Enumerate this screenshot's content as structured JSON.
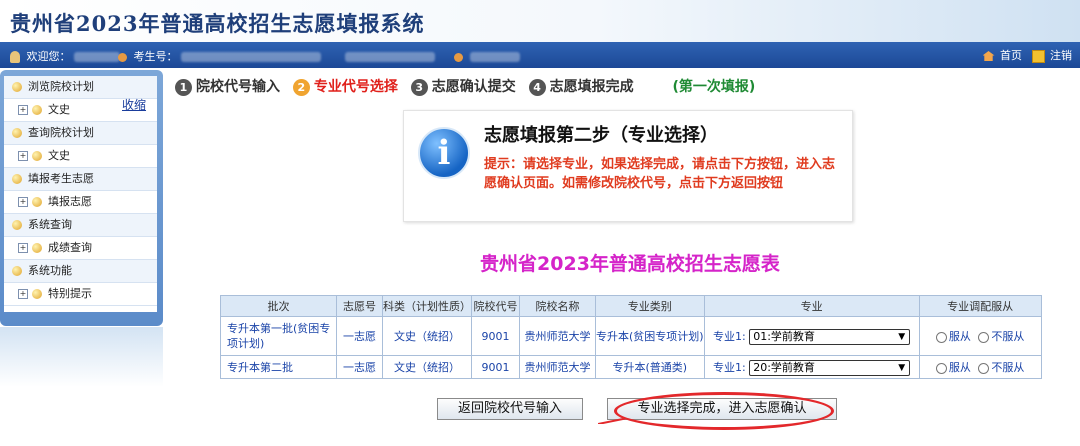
{
  "header": {
    "title": "贵州省2023年普通高校招生志愿填报系统"
  },
  "topbar": {
    "welcome": "欢迎您：",
    "exam_label": "考生号：",
    "nav_home": "首页",
    "nav_logout": "注销"
  },
  "sidebar": {
    "collapse": "收缩",
    "groups": [
      {
        "title": "浏览院校计划",
        "item": "文史"
      },
      {
        "title": "查询院校计划",
        "item": "文史"
      },
      {
        "title": "填报考生志愿",
        "item": "填报志愿"
      },
      {
        "title": "系统查询",
        "item": "成绩查询"
      },
      {
        "title": "系统功能",
        "item": "特别提示"
      }
    ]
  },
  "steps": {
    "items": [
      {
        "num": "1",
        "label": "院校代号输入"
      },
      {
        "num": "2",
        "label": "专业代号选择"
      },
      {
        "num": "3",
        "label": "志愿确认提交"
      },
      {
        "num": "4",
        "label": "志愿填报完成"
      }
    ],
    "note": "(第一次填报)"
  },
  "info": {
    "title": "志愿填报第二步（专业选择）",
    "text": "提示：请选择专业，如果选择完成，请点击下方按钮，进入志愿确认页面。如需修改院校代号，点击下方返回按钮"
  },
  "form_title": "贵州省2023年普通高校招生志愿表",
  "table": {
    "headers": [
      "批次",
      "志愿号",
      "科类（计划性质）",
      "院校代号",
      "院校名称",
      "专业类别",
      "专业",
      "专业调配服从"
    ],
    "rows": [
      {
        "batch": "专升本第一批(贫困专项计划)",
        "choice": "一志愿",
        "category": "文史（统招）",
        "code": "9001",
        "school": "贵州师范大学",
        "type": "专升本(贫困专项计划)",
        "major_label": "专业1:",
        "major_value": "01:学前教育",
        "obey": "服从",
        "not_obey": "不服从"
      },
      {
        "batch": "专升本第二批",
        "choice": "一志愿",
        "category": "文史（统招）",
        "code": "9001",
        "school": "贵州师范大学",
        "type": "专升本(普通类)",
        "major_label": "专业1:",
        "major_value": "20:学前教育",
        "obey": "服从",
        "not_obey": "不服从"
      }
    ]
  },
  "buttons": {
    "back": "返回院校代号输入",
    "next": "专业选择完成，进入志愿确认"
  },
  "colors": {
    "topbar": "#1f4c9b",
    "step_active": "#e0201b",
    "info_text": "#e03b1f",
    "form_title": "#d524c9",
    "annotation": "#e3282b"
  }
}
